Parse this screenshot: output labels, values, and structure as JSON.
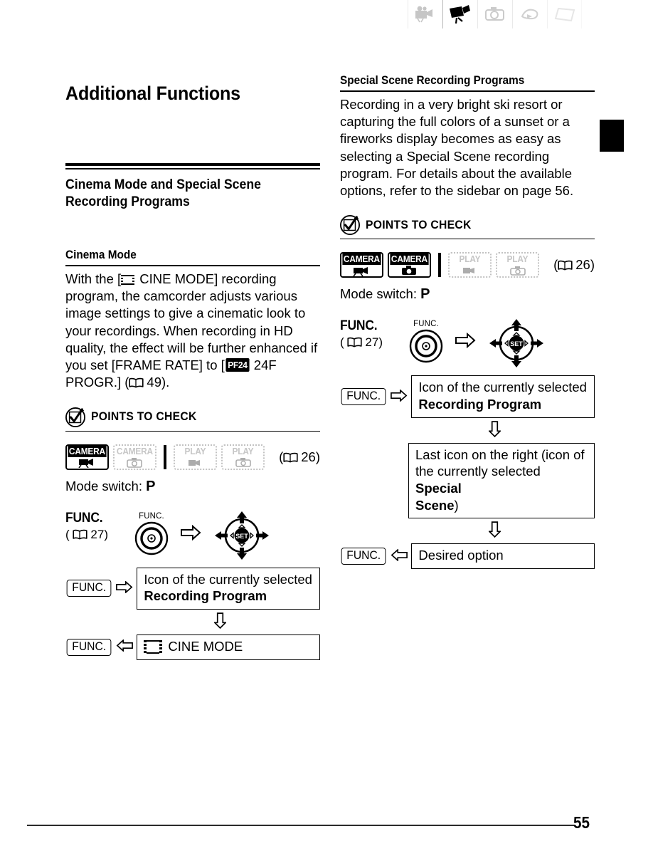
{
  "page": {
    "number": "55",
    "edge_marker_color": "#000000"
  },
  "tabstrip": {
    "items": [
      {
        "name": "tab-camcorder-setup",
        "state": "faded"
      },
      {
        "name": "tab-video-recording",
        "state": "active"
      },
      {
        "name": "tab-photo-recording",
        "state": "faded"
      },
      {
        "name": "tab-playback",
        "state": "faded"
      },
      {
        "name": "tab-memory-card",
        "state": "ghost"
      }
    ]
  },
  "left_column": {
    "chapter_title": "Additional Functions",
    "section_title": "Cinema Mode and Special Scene Recording Programs",
    "subsection": {
      "title": "Cinema Mode",
      "body_part1": "With the [",
      "body_icon": "film-strip-icon",
      "body_part2": " CINE MODE] recording program, the camcorder adjusts various image settings to give a cinematic look to your recordings. When recording in HD quality, the effect will be further enhanced if you set [FRAME RATE] to [",
      "badge_pf24": "PF24",
      "body_part3": " 24F PROGR.] (",
      "page_ref_icon": "book-icon",
      "page_ref": "49",
      "body_part4": ")."
    },
    "points_to_check": {
      "icon": "checkmark-pencil-icon",
      "label": "POINTS TO CHECK",
      "mode_boxes": [
        {
          "top": "CAMERA",
          "icon": "movie-camera-icon",
          "active": true
        },
        {
          "top": "CAMERA",
          "icon": "still-camera-icon",
          "active": false
        },
        {
          "top": "PLAY",
          "icon": "movie-play-icon",
          "active": false
        },
        {
          "top": "PLAY",
          "icon": "still-play-icon",
          "active": false
        }
      ],
      "page_ref_open": "(",
      "page_ref_icon": "book-icon",
      "page_ref": "26",
      "page_ref_close": ")",
      "mode_switch_label": "Mode switch: ",
      "mode_switch_value": "P"
    },
    "operation": {
      "func_title": "FUNC.",
      "func_ref_open": "( ",
      "func_ref_icon": "book-icon",
      "func_ref": "27",
      "func_ref_close": ")",
      "func_button_caption": "FUNC.",
      "arrow": "⇨",
      "joystick_label": "SET"
    },
    "flow": {
      "steps": [
        {
          "tag": "FUNC.",
          "tag_position": "left",
          "arrow": "⇨",
          "line1": "Icon of the currently selected",
          "line2": "Recording Program",
          "line2_bold": true
        },
        {
          "tag": "FUNC.",
          "tag_position": "left",
          "arrow": "⇦",
          "icon": "film-strip-icon",
          "line1": "CINE MODE",
          "line2": "",
          "line2_bold": false
        }
      ],
      "down_arrow": "⇩"
    }
  },
  "right_column": {
    "subsection": {
      "title": "Special Scene Recording Programs",
      "body": "Recording in a very bright ski resort or capturing the full colors of a sunset or a fireworks display becomes as easy as selecting a Special Scene recording program. For details about the available options, refer to the sidebar on page 56."
    },
    "points_to_check": {
      "icon": "checkmark-pencil-icon",
      "label": "POINTS TO CHECK",
      "mode_boxes": [
        {
          "top": "CAMERA",
          "icon": "movie-camera-icon",
          "active": true
        },
        {
          "top": "CAMERA",
          "icon": "still-camera-icon",
          "active": true
        },
        {
          "top": "PLAY",
          "icon": "movie-play-icon",
          "active": false
        },
        {
          "top": "PLAY",
          "icon": "still-play-icon",
          "active": false
        }
      ],
      "page_ref_open": "(",
      "page_ref_icon": "book-icon",
      "page_ref": "26",
      "page_ref_close": ")",
      "mode_switch_label": "Mode switch: ",
      "mode_switch_value": "P"
    },
    "operation": {
      "func_title": "FUNC.",
      "func_ref_open": "( ",
      "func_ref_icon": "book-icon",
      "func_ref": "27",
      "func_ref_close": ")",
      "func_button_caption": "FUNC.",
      "arrow": "⇨",
      "joystick_label": "SET"
    },
    "flow": {
      "steps": [
        {
          "tag": "FUNC.",
          "arrow": "⇨",
          "line1": "Icon of the currently selected",
          "line2": "Recording Program",
          "line2_bold": true
        },
        {
          "tag": "",
          "arrow": "",
          "line1": "Last icon on the right (icon of",
          "line2": "the currently selected ",
          "line2_bold_tail": "Special",
          "line3_bold": "Scene",
          "line3_tail": ")"
        },
        {
          "tag": "FUNC.",
          "arrow": "⇦",
          "line1": "Desired option",
          "line2": "",
          "line2_bold": false
        }
      ],
      "down_arrow": "⇩"
    }
  }
}
